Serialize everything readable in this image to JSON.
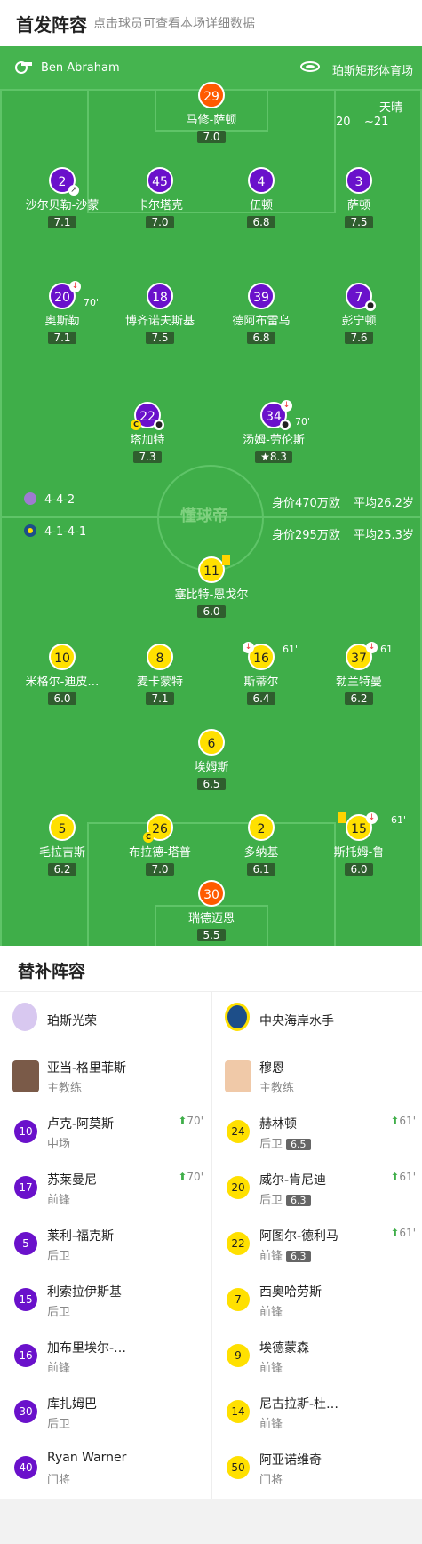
{
  "header": {
    "title": "首发阵容",
    "subtitle": "点击球员可查看本场详细数据"
  },
  "match": {
    "referee": "Ben Abraham",
    "venue": "珀斯矩形体育场",
    "weather": "天晴",
    "temp_low": "20",
    "temp_high": "~21"
  },
  "home": {
    "formation": "4-4-2",
    "value": "身价470万欧",
    "age": "平均26.2岁"
  },
  "away": {
    "formation": "4-1-4-1",
    "value": "身价295万欧",
    "age": "平均25.3岁"
  },
  "watermark": "懂球帝",
  "players": [
    {
      "num": "29",
      "name": "马修-萨顿",
      "rating": "7.0"
    },
    {
      "num": "2",
      "name": "沙尔贝勒-沙蒙",
      "rating": "7.1"
    },
    {
      "num": "45",
      "name": "卡尔塔克",
      "rating": "7.0"
    },
    {
      "num": "4",
      "name": "伍顿",
      "rating": "6.8"
    },
    {
      "num": "3",
      "name": "萨顿",
      "rating": "7.5"
    },
    {
      "num": "20",
      "name": "奥斯勒",
      "rating": "7.1",
      "minute": "70'"
    },
    {
      "num": "18",
      "name": "博齐诺夫斯基",
      "rating": "7.5"
    },
    {
      "num": "39",
      "name": "德阿布雷乌",
      "rating": "6.8"
    },
    {
      "num": "7",
      "name": "彭宁顿",
      "rating": "7.6"
    },
    {
      "num": "22",
      "name": "塔加特",
      "rating": "7.3"
    },
    {
      "num": "34",
      "name": "汤姆-劳伦斯",
      "rating": "8.3",
      "minute": "70'"
    },
    {
      "num": "11",
      "name": "塞比特-恩戈尔",
      "rating": "6.0"
    },
    {
      "num": "10",
      "name": "米格尔-迪皮…",
      "rating": "6.0"
    },
    {
      "num": "8",
      "name": "麦卡蒙特",
      "rating": "7.1"
    },
    {
      "num": "16",
      "name": "斯蒂尔",
      "rating": "6.4",
      "minute": "61'"
    },
    {
      "num": "37",
      "name": "勃兰特曼",
      "rating": "6.2",
      "minute": "61'"
    },
    {
      "num": "6",
      "name": "埃姆斯",
      "rating": "6.5"
    },
    {
      "num": "5",
      "name": "毛拉吉斯",
      "rating": "6.2"
    },
    {
      "num": "26",
      "name": "布拉德-塔普",
      "rating": "7.0"
    },
    {
      "num": "2",
      "name": "多纳基",
      "rating": "6.1"
    },
    {
      "num": "15",
      "name": "斯托姆-鲁",
      "rating": "6.0",
      "minute": "61'"
    },
    {
      "num": "30",
      "name": "瑞德迈恩",
      "rating": "5.5"
    }
  ],
  "subs_title": "替补阵容",
  "home_team": "珀斯光荣",
  "away_team": "中央海岸水手",
  "home_coach": {
    "name": "亚当-格里菲斯",
    "role": "主教练"
  },
  "away_coach": {
    "name": "穆恩",
    "role": "主教练"
  },
  "home_subs": [
    {
      "num": "10",
      "name": "卢克-阿莫斯",
      "pos": "中场",
      "minute": "70'"
    },
    {
      "num": "17",
      "name": "苏莱曼尼",
      "pos": "前锋",
      "minute": "70'"
    },
    {
      "num": "5",
      "name": "莱利-福克斯",
      "pos": "后卫"
    },
    {
      "num": "15",
      "name": "利索拉伊斯基",
      "pos": "后卫"
    },
    {
      "num": "16",
      "name": "加布里埃尔-…",
      "pos": "前锋"
    },
    {
      "num": "30",
      "name": "库扎姆巴",
      "pos": "后卫"
    },
    {
      "num": "40",
      "name": "Ryan Warner",
      "pos": "门将"
    }
  ],
  "away_subs": [
    {
      "num": "24",
      "name": "赫林顿",
      "pos": "后卫",
      "rating": "6.5",
      "minute": "61'"
    },
    {
      "num": "20",
      "name": "威尔-肯尼迪",
      "pos": "后卫",
      "rating": "6.3",
      "minute": "61'"
    },
    {
      "num": "22",
      "name": "阿图尔-德利马",
      "pos": "前锋",
      "rating": "6.3",
      "minute": "61'"
    },
    {
      "num": "7",
      "name": "西奥哈劳斯",
      "pos": "前锋"
    },
    {
      "num": "9",
      "name": "埃德蒙森",
      "pos": "前锋"
    },
    {
      "num": "14",
      "name": "尼古拉斯-杜…",
      "pos": "前锋"
    },
    {
      "num": "50",
      "name": "阿亚诺维奇",
      "pos": "门将"
    }
  ],
  "colors": {
    "home": "#6a11cb",
    "away": "#ffe000",
    "gk": "#ff5a00",
    "pitch": "#3fae49"
  }
}
